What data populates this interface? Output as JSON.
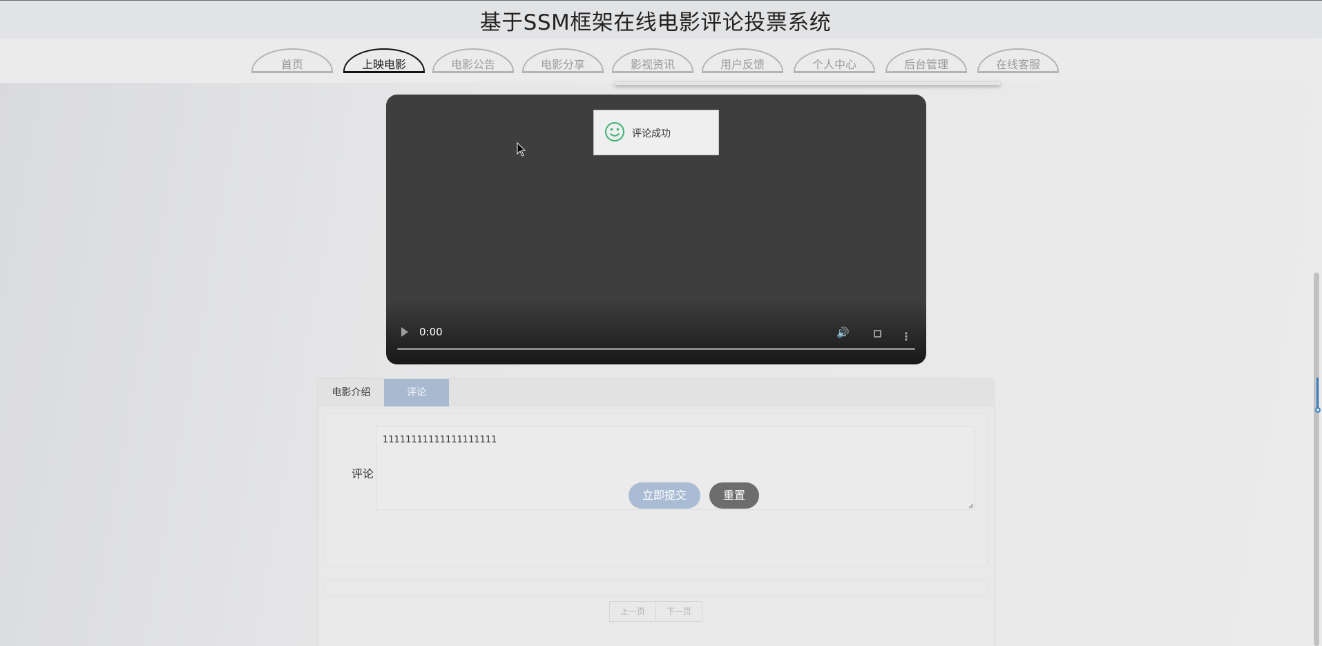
{
  "site": {
    "title": "基于SSM框架在线电影评论投票系统"
  },
  "nav": {
    "items": [
      "首页",
      "上映电影",
      "电影公告",
      "电影分享",
      "影视资讯",
      "用户反馈",
      "个人中心",
      "后台管理",
      "在线客服"
    ],
    "active": "上映电影"
  },
  "video": {
    "time": "0:00",
    "progress": 0
  },
  "toast": {
    "message": "评论成功",
    "icon": "smile-icon",
    "icon_color": "#3cb371"
  },
  "tabs": {
    "intro": "电影介绍",
    "comment": "评论"
  },
  "comment_form": {
    "label": "评论",
    "value": "11111111111111111111",
    "submit_label": "立即提交",
    "reset_label": "重置"
  },
  "pagination": {
    "prev": "上一页",
    "next": "下一页"
  },
  "colors": {
    "accent": "#a8b9d0",
    "reset_button": "#6d6d6d"
  }
}
